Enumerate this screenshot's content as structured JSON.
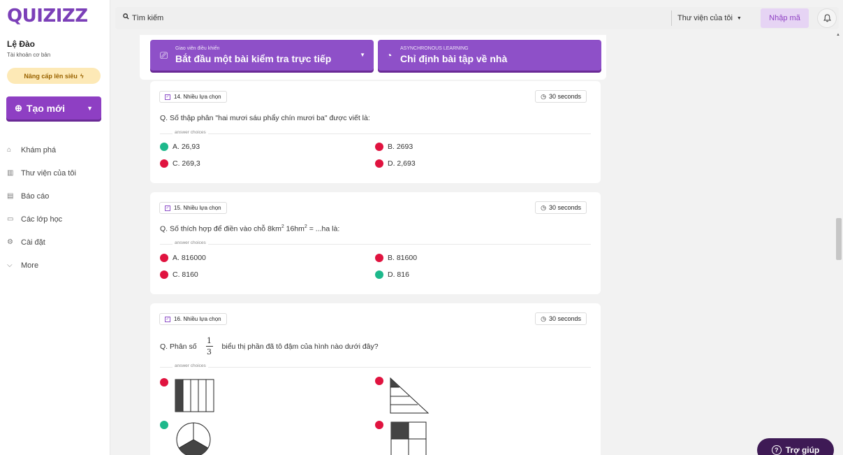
{
  "app": {
    "logo": "QUIZIZZ",
    "brand_color": "#8e3fc3"
  },
  "sidebar": {
    "user_name": "Lệ Đào",
    "user_plan": "Tài khoản cơ bản",
    "upgrade_label": "Nâng cấp lên siêu",
    "create_label": "Tạo mới",
    "items": [
      {
        "label": "Khám phá",
        "icon": "explore-icon"
      },
      {
        "label": "Thư viện của tôi",
        "icon": "library-icon"
      },
      {
        "label": "Báo cáo",
        "icon": "reports-icon"
      },
      {
        "label": "Các lớp học",
        "icon": "classes-icon"
      },
      {
        "label": "Cài đặt",
        "icon": "settings-icon"
      },
      {
        "label": "More",
        "icon": "chevron-down-icon"
      }
    ]
  },
  "topbar": {
    "search_placeholder": "Tìm kiếm",
    "library_dropdown": "Thư viện của tôi",
    "join_label": "Nhập mã"
  },
  "start": {
    "live_small": "Giao viên điều khiển",
    "live_big": "Bắt đầu một bài kiểm tra trực tiếp",
    "hw_small": "ASYNCHRONOUS LEARNING",
    "hw_big": "Chỉ định bài tập về nhà"
  },
  "questions": [
    {
      "type": "14. Nhiều lựa chọn",
      "time": "30 seconds",
      "text": "Q. Số thập phân \"hai mươi sáu phẩy chín mươi ba\" được viết là:",
      "choices_label": "answer choices",
      "choices": [
        {
          "label": "A. 26,93",
          "correct": true
        },
        {
          "label": "B. 2693",
          "correct": false
        },
        {
          "label": "C. 269,3",
          "correct": false
        },
        {
          "label": "D. 2,693",
          "correct": false
        }
      ]
    },
    {
      "type": "15. Nhiều lựa chọn",
      "time": "30 seconds",
      "text_prefix": "Q. Số thích hợp để điền vào chỗ 8km",
      "text_sup1": "2",
      "text_mid": " 16hm",
      "text_sup2": "2",
      "text_suffix": " = ...ha là:",
      "choices_label": "answer choices",
      "choices": [
        {
          "label": "A. 816000",
          "correct": false
        },
        {
          "label": "B. 81600",
          "correct": false
        },
        {
          "label": "C. 8160",
          "correct": false
        },
        {
          "label": "D. 816",
          "correct": true
        }
      ]
    },
    {
      "type": "16. Nhiều lựa chọn",
      "time": "30 seconds",
      "text_prefix": "Q. Phân số",
      "frac_num": "1",
      "frac_den": "3",
      "text_suffix": "biểu thị phần đã tô đậm của hình nào dưới đây?",
      "choices_label": "answer choices",
      "choices": [
        {
          "figure": "rectangle-one-fifth-shaded",
          "correct": false
        },
        {
          "figure": "triangle-tip-shaded",
          "correct": false
        },
        {
          "figure": "circle-one-third-shaded",
          "correct": true
        },
        {
          "figure": "square-one-quarter-shaded",
          "correct": false
        }
      ]
    }
  ],
  "help_label": "Trợ giúp",
  "colors": {
    "correct": "#1db88b",
    "incorrect": "#e0133f",
    "purple": "#8e50c8"
  }
}
